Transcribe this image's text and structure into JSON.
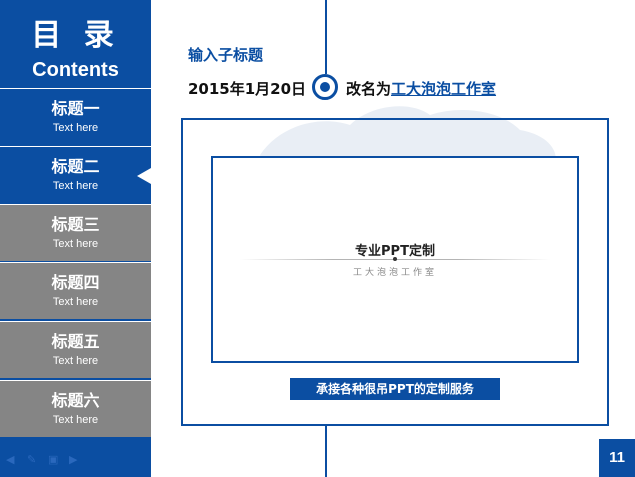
{
  "sidebar": {
    "title": "目 录",
    "subtitle": "Contents",
    "items": [
      {
        "label": "标题一",
        "sub": "Text here"
      },
      {
        "label": "标题二",
        "sub": "Text here"
      },
      {
        "label": "标题三",
        "sub": "Text here"
      },
      {
        "label": "标题四",
        "sub": "Text here"
      },
      {
        "label": "标题五",
        "sub": "Text here"
      },
      {
        "label": "标题六",
        "sub": "Text here"
      }
    ],
    "active_index": 1,
    "nav_icons": [
      "back-arrow-icon",
      "pen-icon",
      "screen-icon",
      "forward-arrow-icon"
    ]
  },
  "main": {
    "subtitle": "输入子标题",
    "date": "2015年1月20日",
    "rename_prefix": "改名为",
    "rename_link": "工大泡泡工作室",
    "center_title": "专业PPT定制",
    "center_sub": "工大泡泡工作室",
    "banner": "承接各种很吊PPT的定制服务"
  },
  "page_number": "11",
  "colors": {
    "accent": "#0b4ea2",
    "inactive": "#858585",
    "background": "#ffffff"
  }
}
